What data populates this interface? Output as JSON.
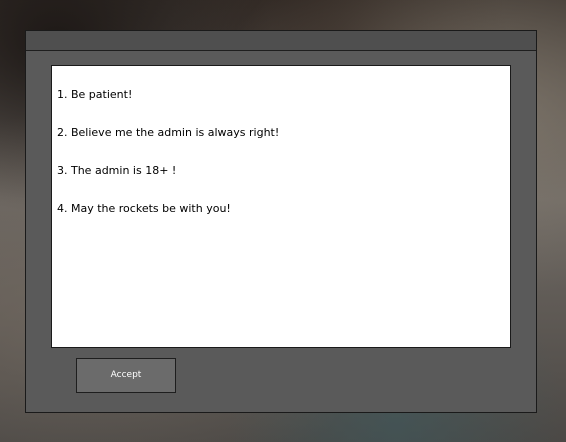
{
  "window": {
    "title": ""
  },
  "rules": [
    "1. Be patient!",
    "2. Believe me the admin is always right!",
    "3. The admin is 18+ !",
    "4. May the rockets be with you!"
  ],
  "accept_button": {
    "label": "Accept"
  }
}
